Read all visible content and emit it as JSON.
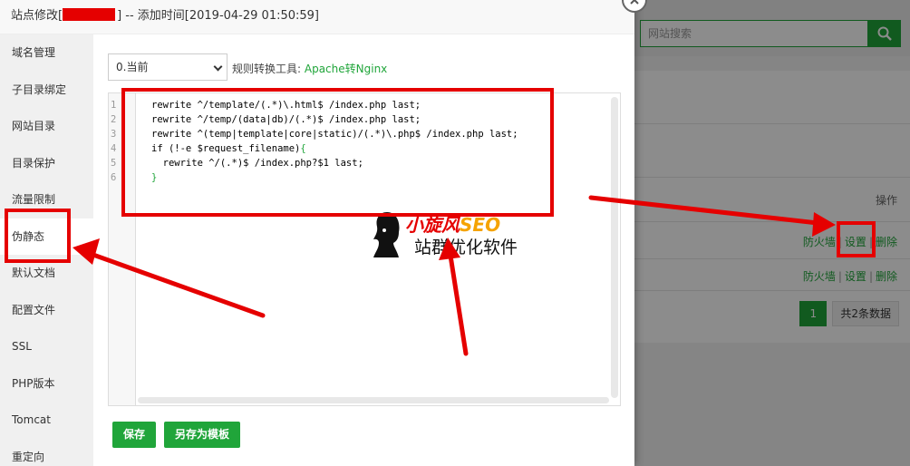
{
  "modal": {
    "title_prefix": "站点修改[",
    "title_suffix": "] -- 添加时间[2019-04-29 01:50:59]",
    "close_icon": "close-icon"
  },
  "sidebar": {
    "items": [
      {
        "label": "域名管理"
      },
      {
        "label": "子目录绑定"
      },
      {
        "label": "网站目录"
      },
      {
        "label": "目录保护"
      },
      {
        "label": "流量限制"
      },
      {
        "label": "伪静态"
      },
      {
        "label": "默认文档"
      },
      {
        "label": "配置文件"
      },
      {
        "label": "SSL"
      },
      {
        "label": "PHP版本"
      },
      {
        "label": "Tomcat"
      },
      {
        "label": "重定向"
      }
    ]
  },
  "rewrite": {
    "select_value": "0.当前",
    "tool_label": "规则转换工具:",
    "tool_link": "Apache转Nginx"
  },
  "editor": {
    "lines": [
      {
        "num": "1",
        "text": "rewrite ^/template/(.*)\\.html$ /index.php last;"
      },
      {
        "num": "2",
        "text": "rewrite ^/temp/(data|db)/(.*)$ /index.php last;"
      },
      {
        "num": "3",
        "text": "rewrite ^(temp|template|core|static)/(.*)\\.php$ /index.php last;"
      },
      {
        "num": "4",
        "text": "if (!-e $request_filename){"
      },
      {
        "num": "5",
        "text": "  rewrite ^/(.*)$ /index.php?$1 last;"
      },
      {
        "num": "6",
        "text": "}"
      }
    ]
  },
  "buttons": {
    "save": "保存",
    "save_template": "另存为模板"
  },
  "background": {
    "search_placeholder": "网站搜索",
    "column_op": "操作",
    "rows": [
      {
        "firewall": "防火墙",
        "settings": "设置",
        "delete": "删除"
      },
      {
        "firewall": "防火墙",
        "settings": "设置",
        "delete": "删除"
      }
    ],
    "separator": "|",
    "pager_current": "1",
    "pager_total": "共2条数据"
  },
  "watermark": {
    "brand_cn": "小旋风",
    "brand_seo": "SEO",
    "subtitle": "站群优化软件"
  },
  "colors": {
    "accent": "#20a53a",
    "annotation": "#e50000"
  }
}
